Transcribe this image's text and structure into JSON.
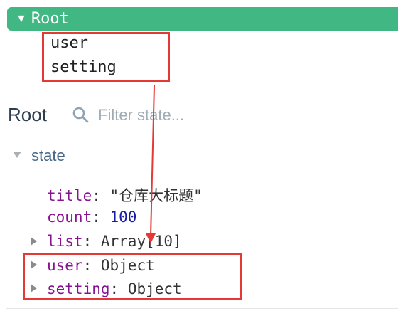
{
  "modules": {
    "root_label": "Root",
    "children": [
      "user",
      "setting"
    ]
  },
  "inspector": {
    "title": "Root",
    "filter_placeholder": "Filter state..."
  },
  "state": {
    "section_label": "state",
    "rows": [
      {
        "key": "title",
        "sep": ": ",
        "value": "\"仓库大标题\""
      },
      {
        "key": "count",
        "sep": ": ",
        "value": "100"
      },
      {
        "key": "list",
        "sep": ": ",
        "value": "Array[10]"
      },
      {
        "key": "user",
        "sep": ": ",
        "value": "Object"
      },
      {
        "key": "setting",
        "sep": ": ",
        "value": "Object"
      }
    ]
  },
  "colors": {
    "accent": "#41b883",
    "annotation": "#e53935",
    "key": "#881391",
    "number": "#1a1aa6"
  }
}
